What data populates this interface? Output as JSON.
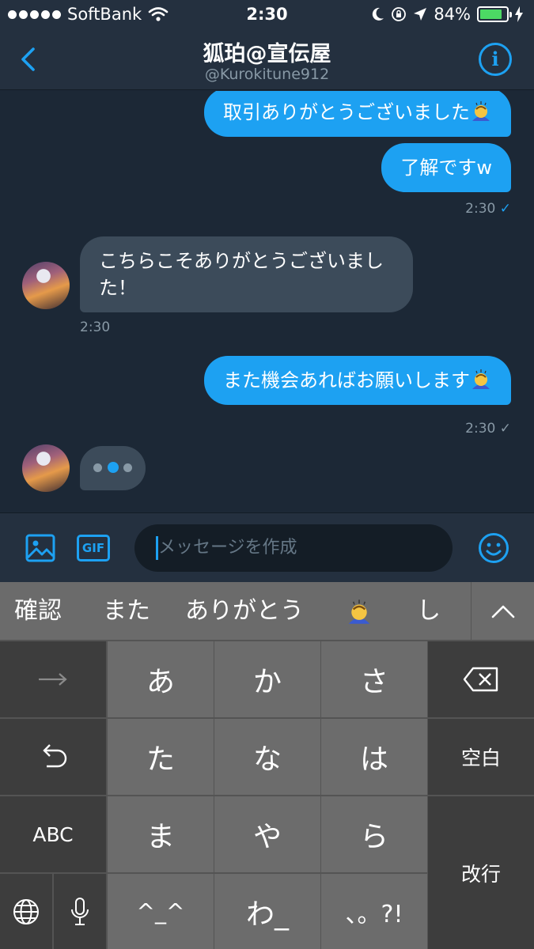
{
  "status_bar": {
    "carrier": "SoftBank",
    "time": "2:30",
    "battery": "84%",
    "battery_level": 0.84
  },
  "header": {
    "name": "狐珀@宣伝屋",
    "handle": "@Kurokitune912"
  },
  "messages": [
    {
      "text": "取引ありがとうございました",
      "from": "me",
      "emoji": "bowing-person-emoji"
    },
    {
      "text": "了解ですw",
      "from": "me"
    },
    {
      "time": "2:30",
      "status": "read"
    },
    {
      "text": "こちらこそありがとうございました！",
      "from": "them",
      "line1": "こちらこそありがとうございまし",
      "line2": "た！"
    },
    {
      "time": "2:30"
    },
    {
      "text": "また機会あればお願いします",
      "from": "me",
      "emoji": "bowing-person-emoji"
    },
    {
      "time": "2:30",
      "status": "sent"
    }
  ],
  "composer": {
    "placeholder": "メッセージを作成",
    "gif_label": "GIF"
  },
  "keyboard": {
    "suggestions": [
      "確認",
      "また",
      "ありがとう",
      "bowing-person-emoji",
      "し"
    ],
    "keys": {
      "a": "あ",
      "ka": "か",
      "sa": "さ",
      "ta": "た",
      "na": "な",
      "ha": "は",
      "ma": "ま",
      "ya": "や",
      "ra": "ら",
      "kaomoji": "^_^",
      "wa": "わ_",
      "punct": "、。?!",
      "space": "空白",
      "enter": "改行",
      "abc": "ABC"
    }
  },
  "colors": {
    "accent": "#1da1f2",
    "background": "#1c2836",
    "received_bubble": "#3c4b5a",
    "header": "#24303f"
  }
}
